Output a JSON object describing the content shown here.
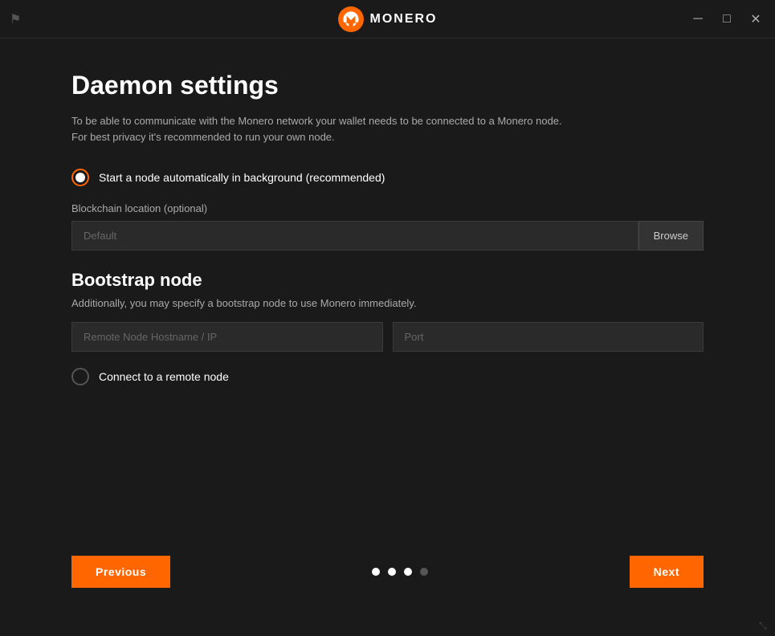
{
  "titlebar": {
    "title": "MONERO",
    "minimize_label": "─",
    "maximize_label": "□",
    "close_label": "✕"
  },
  "page": {
    "title": "Daemon settings",
    "description_line1": "To be able to communicate with the Monero network your wallet needs to be connected to a Monero node.",
    "description_line2": "For best privacy it's recommended to run your own node."
  },
  "radio_option_1": {
    "label": "Start a node automatically in background (recommended)",
    "selected": true
  },
  "blockchain": {
    "label": "Blockchain location (optional)",
    "placeholder": "Default",
    "browse_label": "Browse"
  },
  "bootstrap": {
    "title": "Bootstrap node",
    "description": "Additionally, you may specify a bootstrap node to use Monero immediately.",
    "hostname_placeholder": "Remote Node Hostname / IP",
    "port_placeholder": "Port"
  },
  "radio_option_2": {
    "label": "Connect to a remote node",
    "selected": false
  },
  "navigation": {
    "previous_label": "Previous",
    "next_label": "Next"
  },
  "pagination": {
    "dots": [
      {
        "active": true
      },
      {
        "active": true
      },
      {
        "active": true
      },
      {
        "active": false
      }
    ]
  }
}
